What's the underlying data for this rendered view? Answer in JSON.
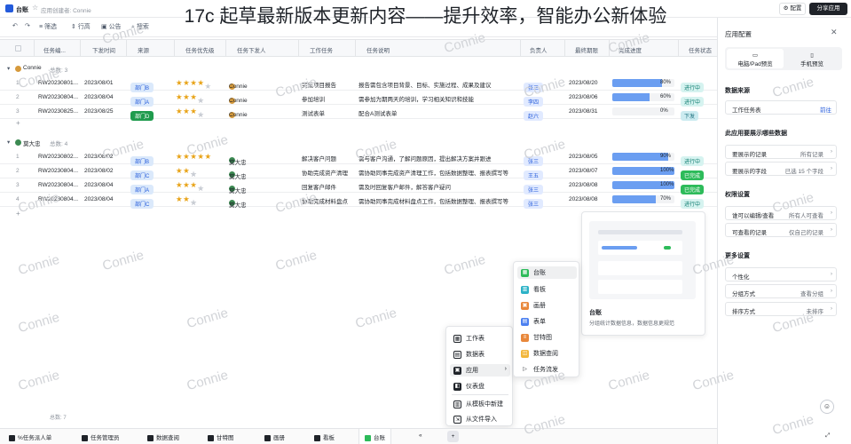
{
  "overlay_title": "17c 起草最新版本更新内容——提升效率，智能办公新体验",
  "topbar": {
    "app_name": "台账",
    "subtitle": "应用创建者: Connie",
    "config_label": "配置",
    "share_label": "分享应用"
  },
  "toolbar": {
    "filter_label": "筛选",
    "rows_label": "行高",
    "announce_label": "公告",
    "search_label": "搜索"
  },
  "columns": [
    "任务编...",
    "下发时间",
    "来源",
    "任务优先级",
    "任务下发人",
    "工作任务",
    "任务说明",
    "负责人",
    "最终期限",
    "完成进度",
    "任务状态"
  ],
  "groups": [
    {
      "name": "Connie",
      "count_label": "总数: 3",
      "rows": [
        {
          "no": "1",
          "id": "RW20230801...",
          "date": "2023/08/01",
          "source": "部门B",
          "src_class": "b1",
          "stars": 4,
          "person": "Connie",
          "task": "完成项目报告",
          "desc": "报告需包含项目背景、目标、实施过程、成果及建议",
          "owner": "张三",
          "deadline": "2023/08/20",
          "progress": 80,
          "progress_label": "80%",
          "status": "进行中",
          "st_class": "st-prog"
        },
        {
          "no": "2",
          "id": "RW20230804...",
          "date": "2023/08/04",
          "source": "部门A",
          "src_class": "b1",
          "stars": 3,
          "person": "Connie",
          "task": "参加培训",
          "desc": "需参加为期两天的培训，学习相关知识和技能",
          "owner": "李四",
          "deadline": "2023/08/06",
          "progress": 60,
          "progress_label": "60%",
          "status": "进行中",
          "st_class": "st-prog"
        },
        {
          "no": "3",
          "id": "RW20230825...",
          "date": "2023/08/25",
          "source": "部门D",
          "src_class": "b2",
          "stars": 3,
          "person": "Connie",
          "task": "测试表单",
          "desc": "配合A测试表单",
          "owner": "赵六",
          "deadline": "2023/08/31",
          "progress": 0,
          "progress_label": "0%",
          "status": "下发",
          "st_class": "st-next"
        }
      ]
    },
    {
      "name": "莫大忠",
      "count_label": "总数: 4",
      "rows": [
        {
          "no": "1",
          "id": "RW20230802...",
          "date": "2023/08/02",
          "source": "部门B",
          "src_class": "b1",
          "stars": 5,
          "person": "莫大忠",
          "task": "解决客户问题",
          "desc": "需与客户沟通，了解问题原因，提出解决方案并跟进",
          "owner": "张三",
          "deadline": "2023/08/05",
          "progress": 90,
          "progress_label": "90%",
          "status": "进行中",
          "st_class": "st-prog"
        },
        {
          "no": "2",
          "id": "RW20230804...",
          "date": "2023/08/02",
          "source": "部门C",
          "src_class": "b1",
          "stars": 2,
          "person": "莫大忠",
          "task": "协助完成资产清理",
          "desc": "需协助同事完成资产清理工作，包括数据整理、报表撰写等",
          "owner": "王五",
          "deadline": "2023/08/07",
          "progress": 100,
          "progress_label": "100%",
          "status": "已完成",
          "st_class": "st-done"
        },
        {
          "no": "3",
          "id": "RW20230804...",
          "date": "2023/08/04",
          "source": "部门A",
          "src_class": "b1",
          "stars": 3,
          "person": "莫大忠",
          "task": "回复客户邮件",
          "desc": "需及时回复客户邮件，解答客户疑问",
          "owner": "张三",
          "deadline": "2023/08/08",
          "progress": 100,
          "progress_label": "100%",
          "status": "已完成",
          "st_class": "st-done"
        },
        {
          "no": "4",
          "id": "RW20230804...",
          "date": "2023/08/04",
          "source": "部门C",
          "src_class": "b1",
          "stars": 2,
          "person": "莫大忠",
          "task": "协助完成材料盘点",
          "desc": "需协助同事完成材料盘点工作，包括数据整理、报表撰写等",
          "owner": "张三",
          "deadline": "2023/08/08",
          "progress": 70,
          "progress_label": "70%",
          "status": "进行中",
          "st_class": "st-prog"
        }
      ]
    }
  ],
  "table_total": "总数: 7",
  "right_panel": {
    "title": "应用配置",
    "tab_pc": "电脑/Pad预览",
    "tab_mobile": "手机预览",
    "sec_source": "数据来源",
    "source_item": "工作任务表",
    "source_action": "前往",
    "sec_display": "此应用要展示哪些数据",
    "records_label": "要展示的记录",
    "records_value": "所有记录",
    "fields_label": "要展示的字段",
    "fields_value": "已选 15 个字段",
    "sec_perm": "权限设置",
    "edit_label": "谁可以编辑/查看",
    "edit_value": "所有人可查看",
    "view_label": "可查看的记录",
    "view_value": "仅自己的记录",
    "sec_more": "更多设置",
    "personal_label": "个性化",
    "group_label": "分组方式",
    "group_value": "查看分组",
    "sort_label": "排序方式",
    "sort_value": "未排序"
  },
  "menu_main": [
    "工作表",
    "数据表",
    "应用",
    "仪表盘",
    "从模板中新建",
    "从文件导入"
  ],
  "menu_sub": [
    "台账",
    "看板",
    "画册",
    "表单",
    "甘特图",
    "数据查阅",
    "任务流发"
  ],
  "preview": {
    "title": "台账",
    "desc": "分组统计数据信息，数据信息更规范"
  },
  "bottom_tabs": [
    "%任务派人单",
    "任务管理员",
    "数据查阅",
    "甘特图",
    "画册",
    "看板",
    "台账"
  ],
  "watermark": "Connie"
}
